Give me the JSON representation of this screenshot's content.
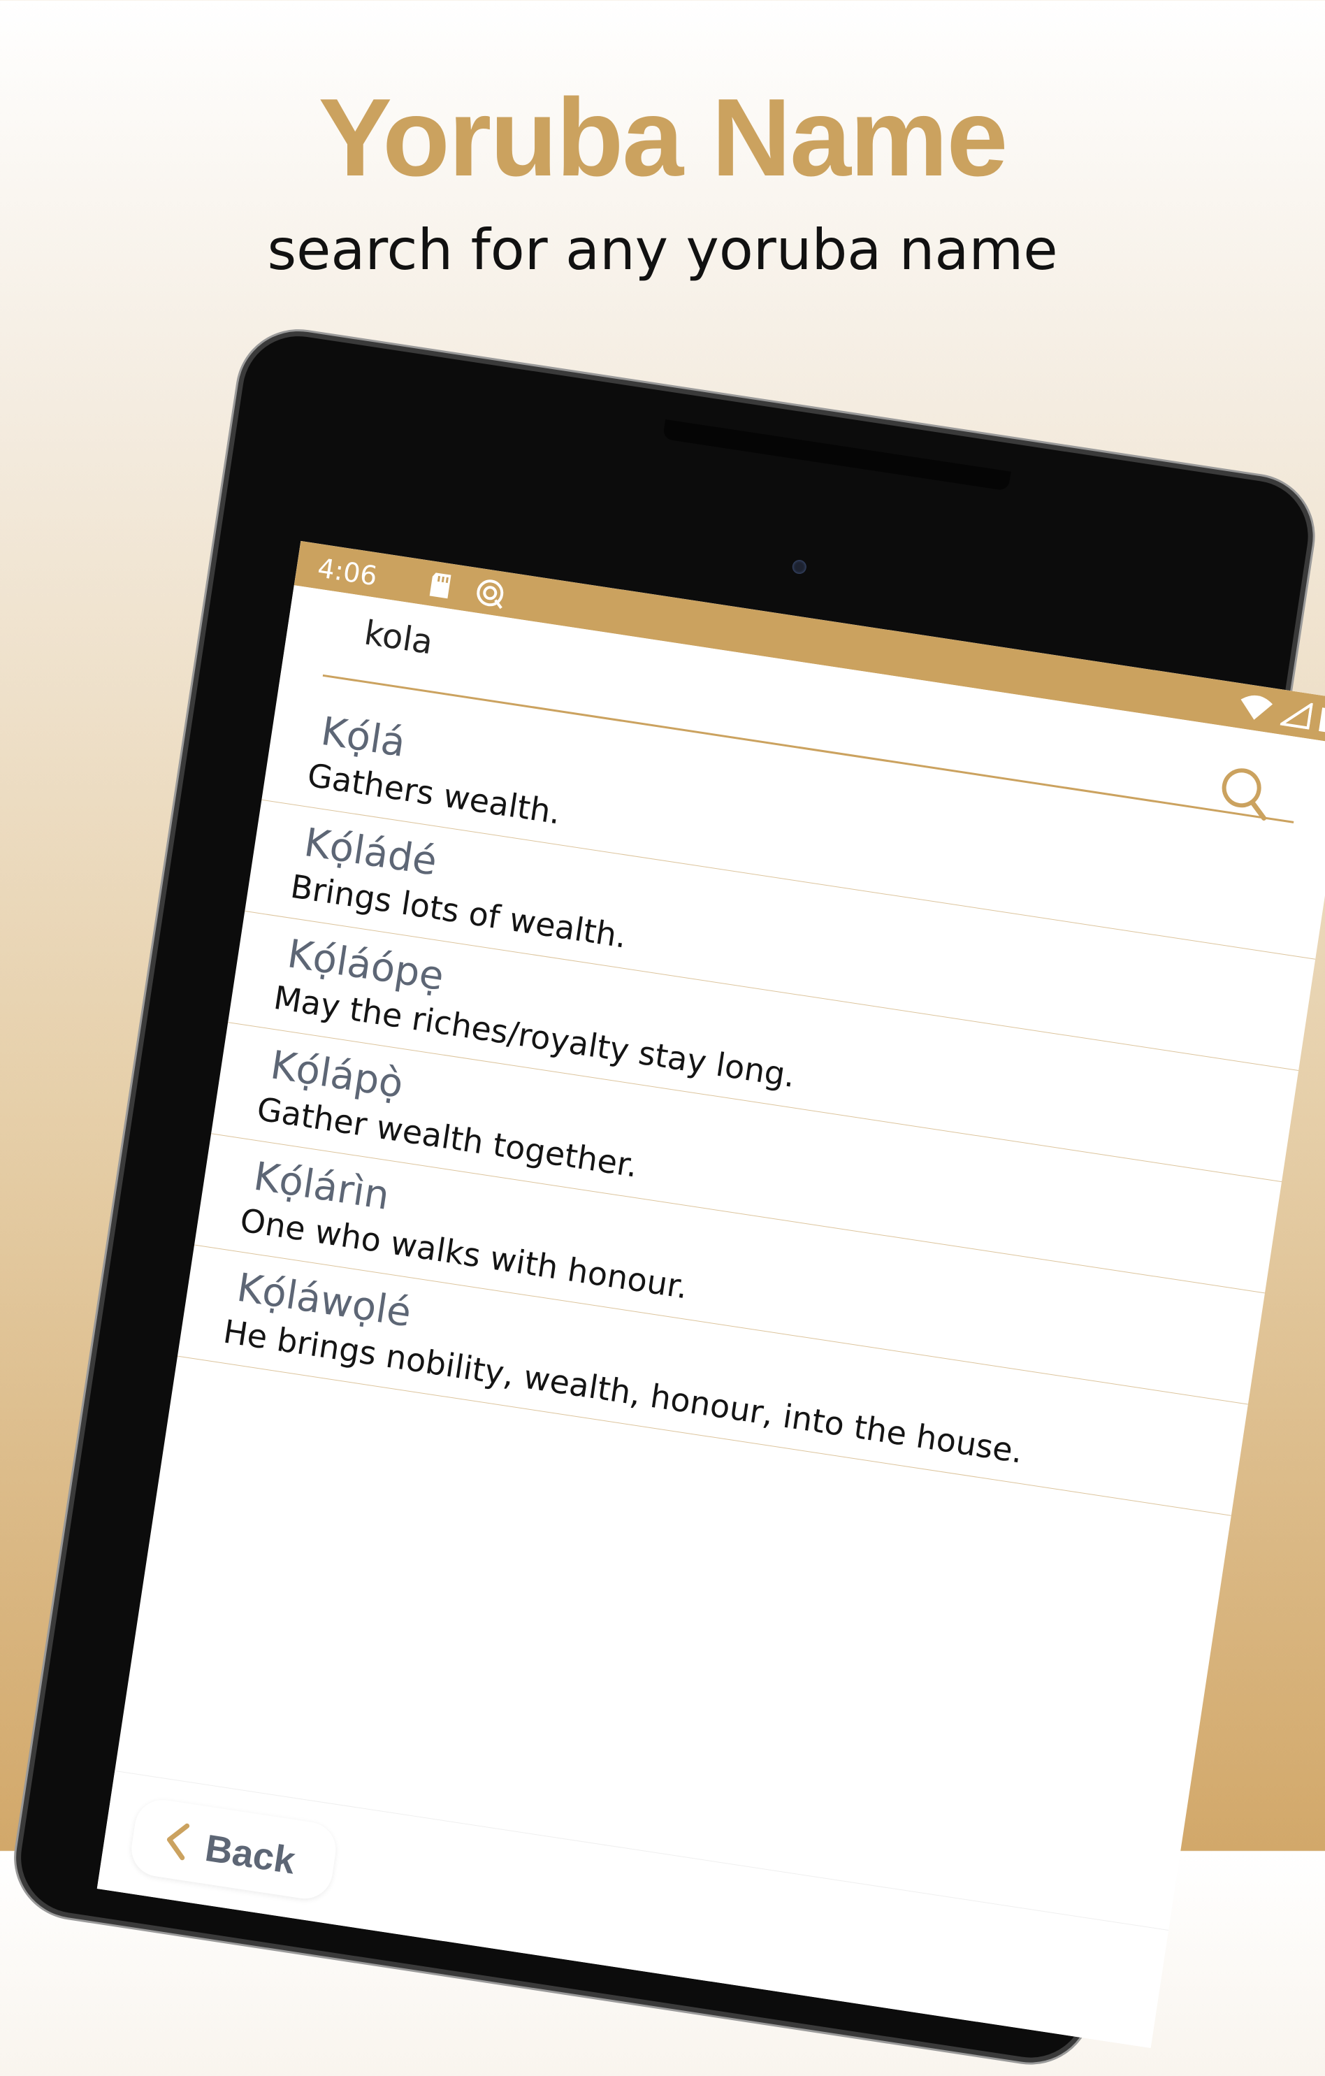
{
  "promo": {
    "title": "Yoruba Name",
    "subtitle": "search for any yoruba name"
  },
  "colors": {
    "accent": "#cba25f",
    "name_text": "#5d6675",
    "meaning_text": "#141414",
    "divider": "#dcc49c"
  },
  "statusbar": {
    "time": "4:06",
    "icons": [
      "sd-card-icon",
      "sync-icon",
      "wifi-icon",
      "cell-signal-icon",
      "battery-icon"
    ]
  },
  "search": {
    "value": "kola",
    "icon": "search-icon"
  },
  "results": [
    {
      "name": "Kọ́lá",
      "meaning": "Gathers wealth."
    },
    {
      "name": "Kọ́ládé",
      "meaning": "Brings lots of wealth."
    },
    {
      "name": "Kọ́láópẹ",
      "meaning": "May the riches/royalty stay long."
    },
    {
      "name": "Kọ́lápọ̀",
      "meaning": "Gather wealth together."
    },
    {
      "name": "Kọ́lárìn",
      "meaning": "One who walks with honour."
    },
    {
      "name": "Kọ́láwọlé",
      "meaning": "He brings nobility, wealth, honour, into the house."
    }
  ],
  "bottom": {
    "back_label": "Back",
    "back_icon": "chevron-left-icon"
  }
}
